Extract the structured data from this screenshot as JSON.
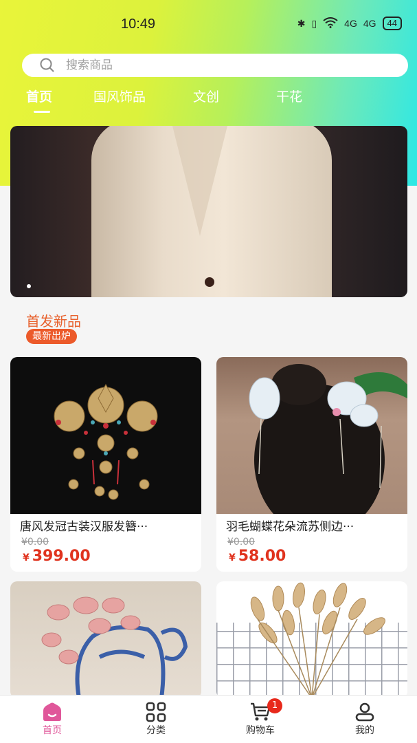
{
  "status_bar": {
    "time": "10:49",
    "battery": "44",
    "signal1": "4G",
    "signal2": "4G"
  },
  "search": {
    "placeholder": "搜索商品"
  },
  "tabs": [
    {
      "label": "首页",
      "active": true
    },
    {
      "label": "国风饰品",
      "active": false
    },
    {
      "label": "文创",
      "active": false
    },
    {
      "label": "干花",
      "active": false
    }
  ],
  "banner": {
    "page_count": 1,
    "current_page": 1
  },
  "section": {
    "title": "首发新品",
    "badge": "最新出炉"
  },
  "products": [
    {
      "name": "唐风发冠古装汉服发簪···",
      "old_price": "¥0.00",
      "currency": "¥",
      "price": "399.00"
    },
    {
      "name": "羽毛蝴蝶花朵流苏侧边···",
      "old_price": "¥0.00",
      "currency": "¥",
      "price": "58.00"
    }
  ],
  "bottom_nav": [
    {
      "label": "首页",
      "icon": "home-icon",
      "active": true
    },
    {
      "label": "分类",
      "icon": "grid-icon",
      "active": false
    },
    {
      "label": "购物车",
      "icon": "cart-icon",
      "active": false,
      "badge": "1"
    },
    {
      "label": "我的",
      "icon": "user-icon",
      "active": false
    }
  ],
  "colors": {
    "accent": "#e0579a",
    "price": "#e0331e",
    "section": "#e8622e"
  }
}
